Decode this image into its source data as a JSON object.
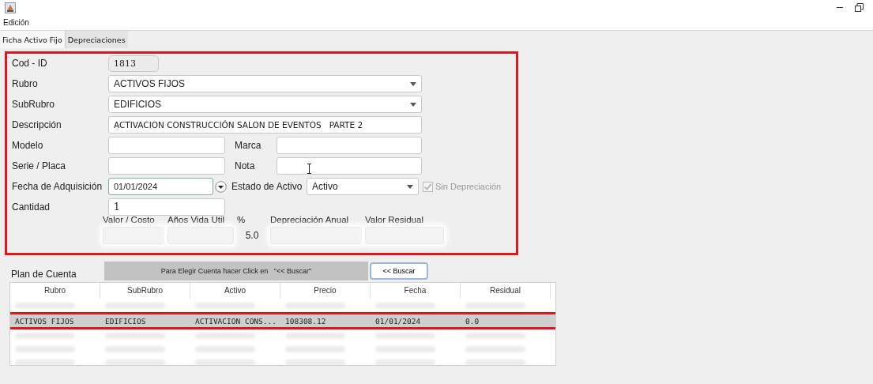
{
  "menu": [
    "Edición"
  ],
  "tabs": [
    {
      "label": "Ficha Activo Fijo",
      "selected": true
    },
    {
      "label": "Depreciaciones",
      "selected": false
    }
  ],
  "form": {
    "cod_id": {
      "label": "Cod - ID",
      "value": "1813"
    },
    "rubro": {
      "label": "Rubro",
      "value": "ACTIVOS FIJOS"
    },
    "subrubro": {
      "label": "SubRubro",
      "value": "EDIFICIOS"
    },
    "descripcion": {
      "label": "Descripción",
      "value": "ACTIVACION CONSTRUCCIÓN SALON DE EVENTOS   PARTE 2"
    },
    "modelo": {
      "label": "Modelo"
    },
    "marca": {
      "label": "Marca"
    },
    "serie": {
      "label": "Serie / Placa"
    },
    "nota": {
      "label": "Nota"
    },
    "fecha": {
      "label": "Fecha de Adquisición",
      "value": "01/01/2024"
    },
    "estado": {
      "label": "Estado de Activo",
      "value": "Activo"
    },
    "sin_depreciacion": {
      "label": "Sin Depreciación",
      "checked": true,
      "disabled": true
    },
    "cantidad": {
      "label": "Cantidad",
      "value": "1"
    },
    "valor_costo": {
      "label": "Valor / Costo",
      "redacted": true
    },
    "anos_vida": {
      "label": "Años Vida Util",
      "redacted": true
    },
    "porcentaje": {
      "label": "%",
      "value": "5.0"
    },
    "depreciacion_anual": {
      "label": "Depreciación Anual",
      "redacted": true
    },
    "valor_residual": {
      "label": "Valor Residual",
      "redacted": true
    }
  },
  "plan_de_cuenta": {
    "label": "Plan de Cuenta",
    "hint": "Para Elegir Cuenta hacer Click en   \"<< Buscar\"",
    "button": "<< Buscar"
  },
  "table": {
    "columns": [
      "Rubro",
      "SubRubro",
      "Activo",
      "Precio",
      "Fecha",
      "Residual"
    ],
    "rows": [
      {
        "kind": "redacted",
        "selected": false
      },
      {
        "kind": "data",
        "selected": true,
        "cells": [
          "ACTIVOS FIJOS",
          "EDIFICIOS",
          "ACTIVACION CONS...",
          "108308.12",
          "01/01/2024",
          "0.0"
        ]
      },
      {
        "kind": "redacted",
        "selected": false
      },
      {
        "kind": "redacted",
        "selected": false
      },
      {
        "kind": "redacted",
        "selected": false
      }
    ]
  }
}
